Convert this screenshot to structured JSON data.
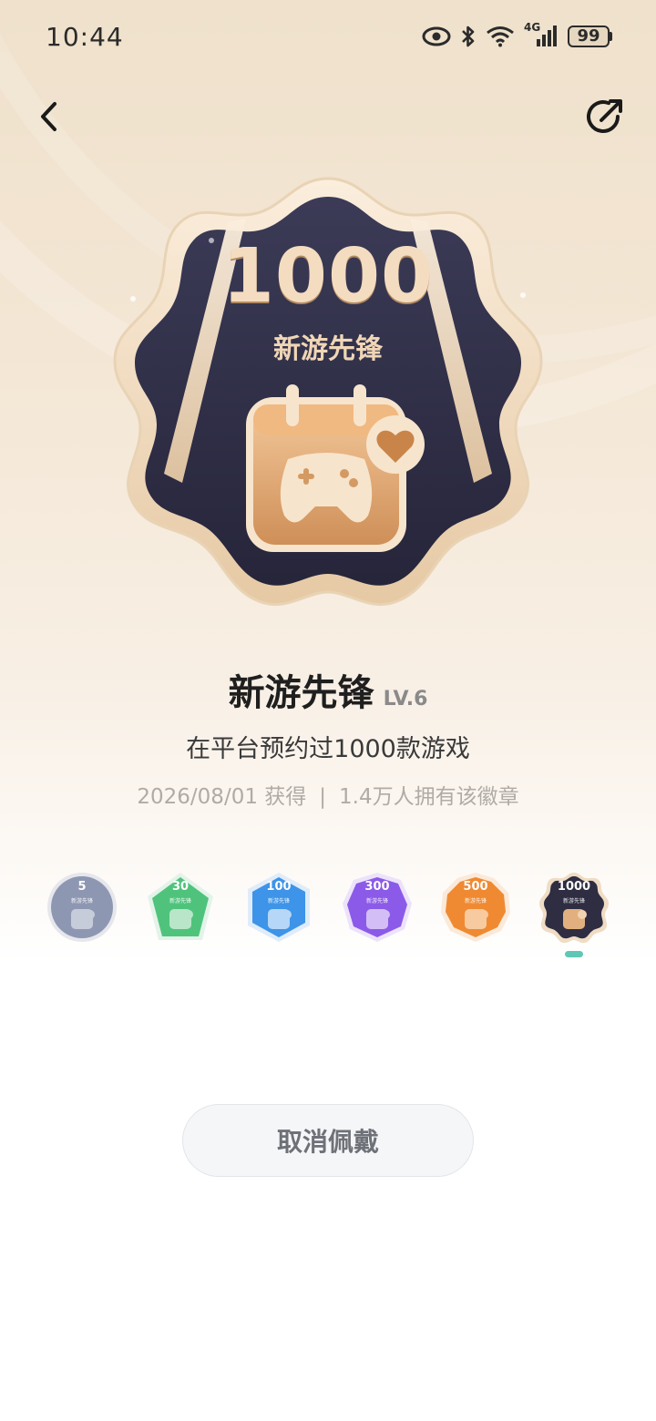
{
  "status_bar": {
    "time": "10:44",
    "network": "4G",
    "battery": "99",
    "icons": [
      "eye-icon",
      "bluetooth-icon",
      "wifi-icon",
      "signal-icon",
      "battery-icon"
    ]
  },
  "nav": {
    "back_icon": "chevron-left-icon",
    "share_icon": "share-icon"
  },
  "badge": {
    "number": "1000",
    "name": "新游先锋"
  },
  "info": {
    "title": "新游先锋",
    "level": "LV.6",
    "description": "在平台预约过1000款游戏",
    "obtained_date": "2026/08/01 获得",
    "separator": "|",
    "owners": "1.4万人拥有该徽章"
  },
  "levels": [
    {
      "num": "5",
      "sub": "新游先锋",
      "color": "#8e97b2"
    },
    {
      "num": "30",
      "sub": "新游先锋",
      "color": "#4fc37c"
    },
    {
      "num": "100",
      "sub": "新游先锋",
      "color": "#3d94e8"
    },
    {
      "num": "300",
      "sub": "新游先锋",
      "color": "#8c5ae8"
    },
    {
      "num": "500",
      "sub": "新游先锋",
      "color": "#ef8a32"
    },
    {
      "num": "1000",
      "sub": "新游先锋",
      "color": "#2e2d42"
    }
  ],
  "actions": {
    "cancel_label": "取消佩戴"
  }
}
